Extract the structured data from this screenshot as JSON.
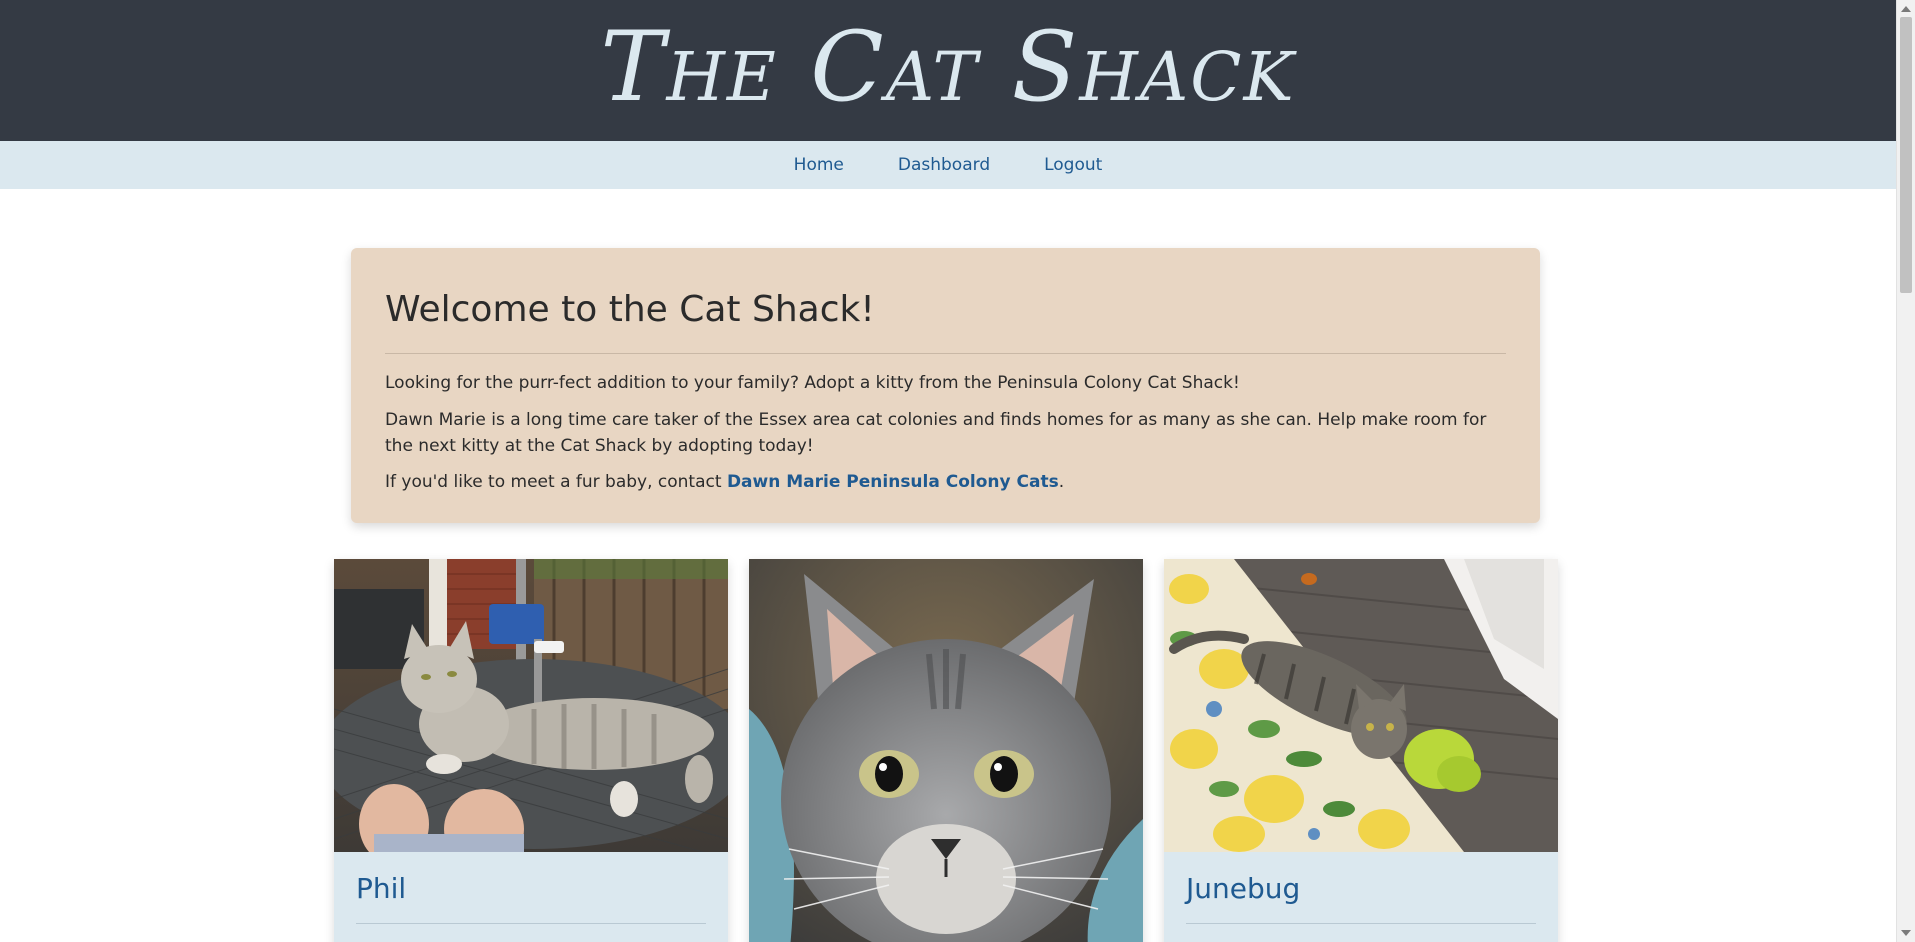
{
  "header": {
    "title": "The Cat Shack"
  },
  "nav": {
    "items": [
      {
        "label": "Home"
      },
      {
        "label": "Dashboard"
      },
      {
        "label": "Logout"
      }
    ]
  },
  "welcome": {
    "heading": "Welcome to the Cat Shack!",
    "paragraph1": "Looking for the purr-fect addition to your family? Adopt a kitty from the Peninsula Colony Cat Shack!",
    "paragraph2": "Dawn Marie is a long time care taker of the Essex area cat colonies and finds homes for as many as she can. Help make room for the next kitty at the Cat Shack by adopting today!",
    "paragraph3_prefix": "If you'd like to meet a fur baby, contact ",
    "contact_link": "Dawn Marie Peninsula Colony Cats",
    "paragraph3_suffix": "."
  },
  "cats": [
    {
      "name": "Phil"
    },
    {
      "name": ""
    },
    {
      "name": "Junebug"
    }
  ],
  "colors": {
    "header_bg": "#343a44",
    "title_color": "#dbe8ef",
    "nav_bg": "#dbe8ef",
    "link_color": "#1f5a91",
    "jumbotron_bg": "#e8d6c3",
    "card_body_bg": "#dbe8ef"
  }
}
